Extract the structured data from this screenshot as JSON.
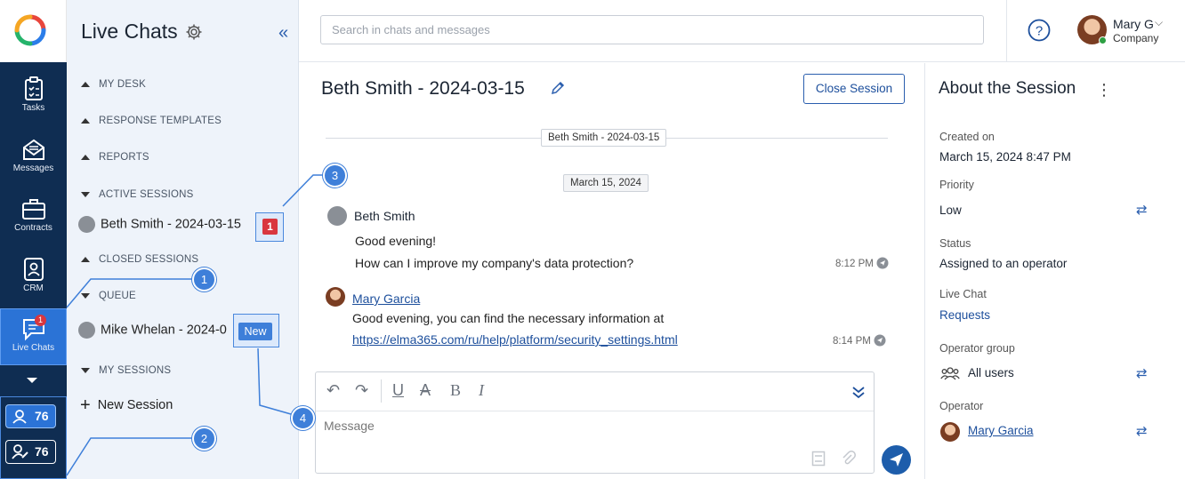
{
  "nav": {
    "items": [
      {
        "label": "Tasks",
        "icon": "clipboard-icon"
      },
      {
        "label": "Messages",
        "icon": "envelope-icon"
      },
      {
        "label": "Contracts",
        "icon": "briefcase-icon"
      },
      {
        "label": "CRM",
        "icon": "contact-card-icon"
      },
      {
        "label": "Live Chats",
        "icon": "chat-bubble-icon",
        "badge": "1"
      }
    ],
    "counters": [
      "76",
      "76"
    ]
  },
  "sidebar": {
    "title": "Live Chats",
    "sections": {
      "my_desk": "MY DESK",
      "response_templates": "RESPONSE TEMPLATES",
      "reports": "REPORTS",
      "active_sessions": "ACTIVE SESSIONS",
      "closed_sessions": "CLOSED SESSIONS",
      "queue": "QUEUE",
      "my_sessions": "MY SESSIONS"
    },
    "active_session": {
      "name": "Beth Smith - 2024-03-15",
      "unread": "1"
    },
    "queue_session": {
      "name": "Mike Whelan - 2024-0",
      "badge": "New"
    },
    "new_session": "New Session"
  },
  "topbar": {
    "search_placeholder": "Search in chats and messages",
    "user_name": "Mary G",
    "user_company": "Company"
  },
  "chat": {
    "title": "Beth Smith - 2024-03-15",
    "close_label": "Close Session",
    "session_chip": "Beth Smith - 2024-03-15",
    "date_chip": "March 15, 2024",
    "messages": [
      {
        "author": "Beth Smith",
        "lines": [
          "Good evening!",
          "How can I improve my company's data protection?"
        ],
        "time": "8:12 PM"
      },
      {
        "author": "Mary Garcia",
        "lines": [
          "Good evening, you can find the necessary information at"
        ],
        "link": "https://elma365.com/ru/help/platform/security_settings.html",
        "time": "8:14 PM"
      }
    ],
    "composer_placeholder": "Message"
  },
  "about": {
    "title": "About the Session",
    "created_on_label": "Created on",
    "created_on": "March 15, 2024 8:47 PM",
    "priority_label": "Priority",
    "priority": "Low",
    "status_label": "Status",
    "status": "Assigned to an operator",
    "live_chat_label": "Live Chat",
    "live_chat": "Requests",
    "operator_group_label": "Operator group",
    "operator_group": "All users",
    "operator_label": "Operator",
    "operator": "Mary Garcia"
  },
  "callouts": [
    "1",
    "2",
    "3",
    "4"
  ],
  "colors": {
    "nav_bg": "#0f2d52",
    "accent": "#2b73d6",
    "sidebar_bg": "#eef3fa",
    "badge_red": "#d9363e",
    "link": "#1d4f9c"
  }
}
